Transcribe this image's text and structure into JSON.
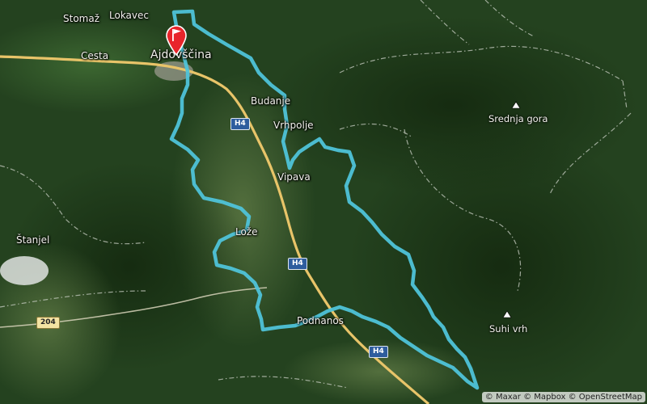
{
  "places": [
    {
      "id": "stomaz",
      "label": "Stomaž"
    },
    {
      "id": "lokavec",
      "label": "Lokavec"
    },
    {
      "id": "cesta",
      "label": "Cesta"
    },
    {
      "id": "ajdovscina",
      "label": "Ajdovščina"
    },
    {
      "id": "budanje",
      "label": "Budanje"
    },
    {
      "id": "vrhpolje",
      "label": "Vrhpolje"
    },
    {
      "id": "vipava",
      "label": "Vipava"
    },
    {
      "id": "loze",
      "label": "Lože"
    },
    {
      "id": "stanjel",
      "label": "Štanjel"
    },
    {
      "id": "podnanos",
      "label": "Podnanos"
    }
  ],
  "peaks": [
    {
      "id": "srednja-gora",
      "label": "Srednja gora"
    },
    {
      "id": "suhi-vrh",
      "label": "Suhi vrh"
    }
  ],
  "road_shields": [
    {
      "id": "h4-north",
      "label": "H4",
      "kind": "highway"
    },
    {
      "id": "h4-mid",
      "label": "H4",
      "kind": "highway"
    },
    {
      "id": "h4-south",
      "label": "H4",
      "kind": "highway"
    },
    {
      "id": "r204",
      "label": "204",
      "kind": "regional"
    }
  ],
  "route": {
    "color": "#4fc3d9",
    "start_marker_color": "#e8252b"
  },
  "attribution": {
    "maxar": "© Maxar",
    "mapbox": "© Mapbox",
    "osm": "© OpenStreetMap"
  }
}
